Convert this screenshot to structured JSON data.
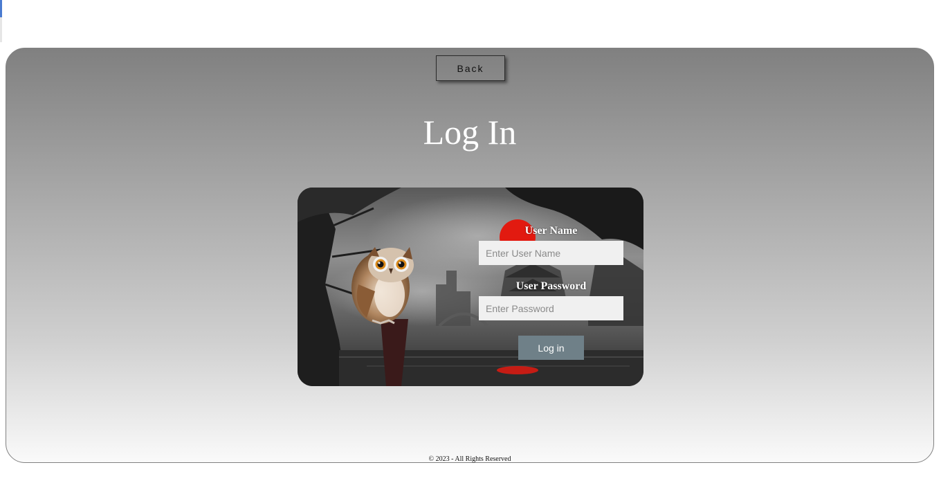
{
  "back_button": {
    "label": "Back"
  },
  "page_title": "Log In",
  "login_form": {
    "username_label": "User Name",
    "username_placeholder": "Enter User Name",
    "username_value": "",
    "password_label": "User Password",
    "password_placeholder": "Enter Password",
    "password_value": "",
    "submit_label": "Log in"
  },
  "footer": {
    "text": "© 2023 - All Rights Reserved"
  },
  "colors": {
    "panel_top": "#808080",
    "panel_bottom": "#fafafa",
    "login_button": "#6f8088",
    "sun_red": "#e21a10"
  },
  "icons": {
    "card_image": "owl-night-landscape-illustration"
  }
}
